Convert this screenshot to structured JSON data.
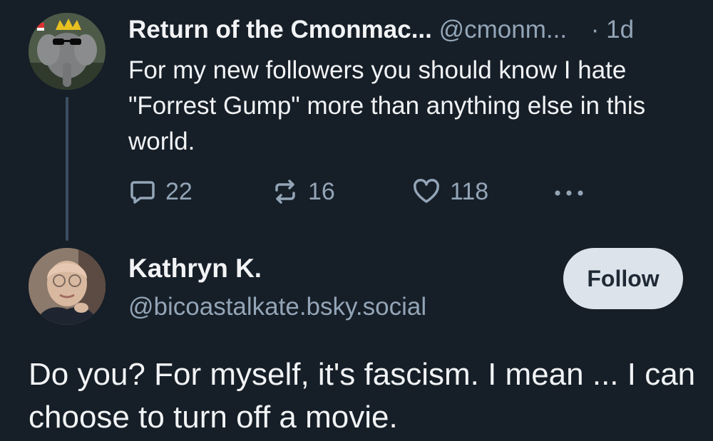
{
  "post1": {
    "author_name": "Return of the Cmonmac...",
    "handle": "@cmonm...",
    "time": "· 1d",
    "text": "For my new followers you should know I hate \"Forrest Gump\" more than anything else in this world.",
    "actions": {
      "reply_icon": "speech-bubble-icon",
      "reply_count": "22",
      "repost_icon": "repost-icon",
      "repost_count": "16",
      "like_icon": "heart-icon",
      "like_count": "118",
      "more_icon": "ellipsis-icon"
    }
  },
  "post2": {
    "author_name": "Kathryn K.",
    "handle": "@bicoastalkate.bsky.social",
    "follow_label": "Follow",
    "text": "Do you?  For myself, it's fascism.  I mean ... I can choose to turn off a movie."
  },
  "colors": {
    "background": "#161e27",
    "text": "#f1f3f5",
    "muted": "#93a5b7",
    "follow_bg": "#dce3ea"
  }
}
